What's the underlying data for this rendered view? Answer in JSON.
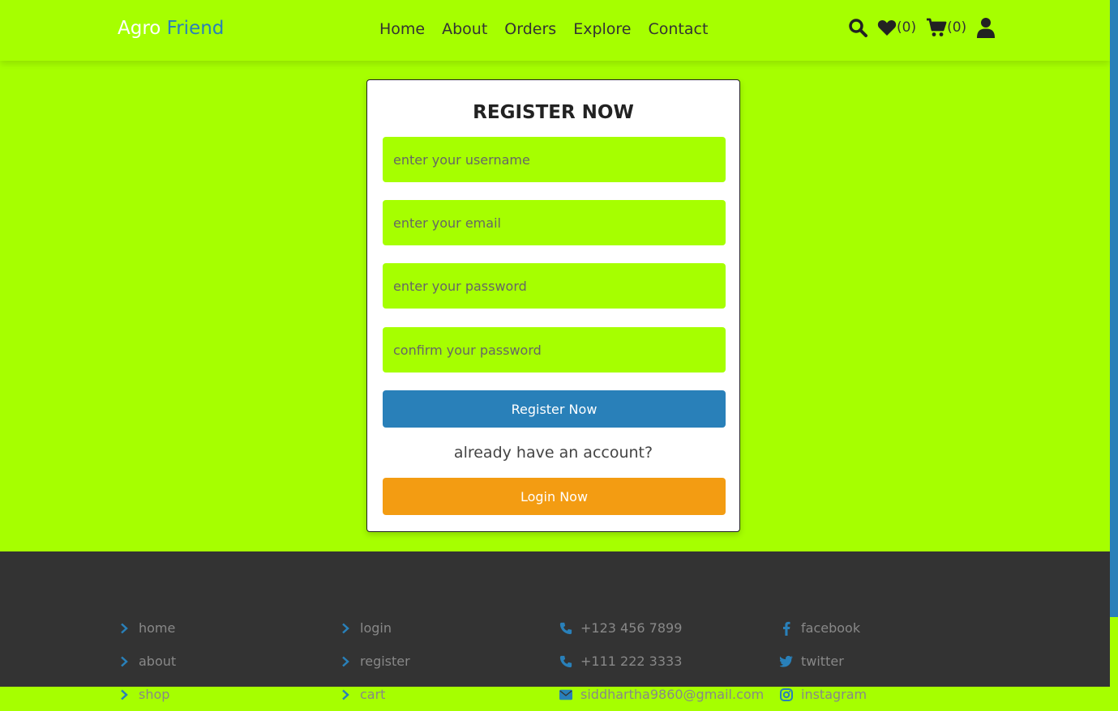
{
  "header": {
    "logo_part1": "Agro",
    "logo_part2": "Friend",
    "nav": [
      "Home",
      "About",
      "Orders",
      "Explore",
      "Contact"
    ],
    "wishlist_count": "(0)",
    "cart_count": "(0)"
  },
  "form": {
    "title": "REGISTER NOW",
    "username_placeholder": "enter your username",
    "email_placeholder": "enter your email",
    "password_placeholder": "enter your password",
    "confirm_placeholder": "confirm your password",
    "register_label": "Register Now",
    "already_text": "already have an account?",
    "login_label": "Login Now"
  },
  "footer": {
    "col1": [
      "home",
      "about",
      "shop"
    ],
    "col2": [
      "login",
      "register",
      "cart"
    ],
    "phone1": "+123 456 7899",
    "phone2": "+111 222 3333",
    "email": "siddhartha9860@gmail.com",
    "social": [
      "facebook",
      "twitter",
      "instagram"
    ]
  },
  "colors": {
    "primary_green": "#a6ff00",
    "blue": "#2980b9",
    "orange": "#f39c12",
    "footer_bg": "#333333"
  }
}
